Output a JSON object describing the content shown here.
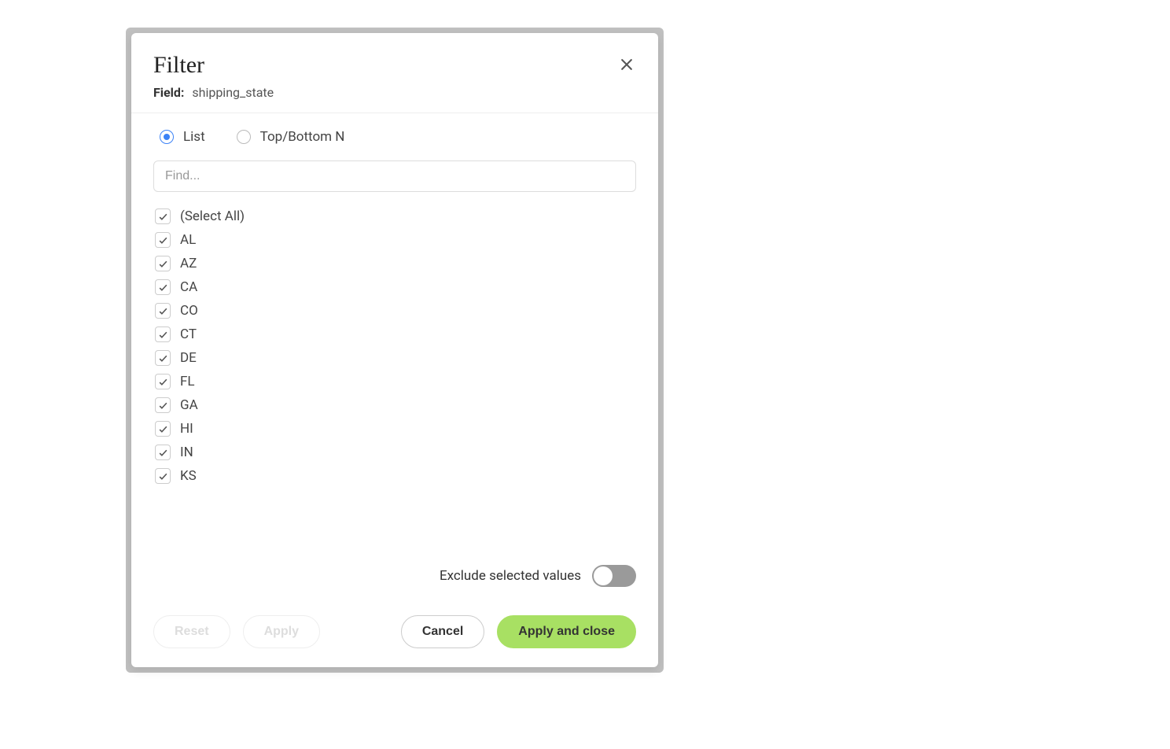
{
  "modal": {
    "title": "Filter",
    "field_label": "Field:",
    "field_value": "shipping_state",
    "radio": {
      "list_label": "List",
      "topbottom_label": "Top/Bottom N",
      "selected": "list"
    },
    "search": {
      "placeholder": "Find..."
    },
    "items": [
      {
        "label": "(Select All)",
        "checked": true
      },
      {
        "label": "AL",
        "checked": true
      },
      {
        "label": "AZ",
        "checked": true
      },
      {
        "label": "CA",
        "checked": true
      },
      {
        "label": "CO",
        "checked": true
      },
      {
        "label": "CT",
        "checked": true
      },
      {
        "label": "DE",
        "checked": true
      },
      {
        "label": "FL",
        "checked": true
      },
      {
        "label": "GA",
        "checked": true
      },
      {
        "label": "HI",
        "checked": true
      },
      {
        "label": "IN",
        "checked": true
      },
      {
        "label": "KS",
        "checked": true
      }
    ],
    "exclude": {
      "label": "Exclude selected values",
      "enabled": false
    },
    "buttons": {
      "reset": "Reset",
      "apply": "Apply",
      "cancel": "Cancel",
      "apply_close": "Apply and close"
    }
  }
}
